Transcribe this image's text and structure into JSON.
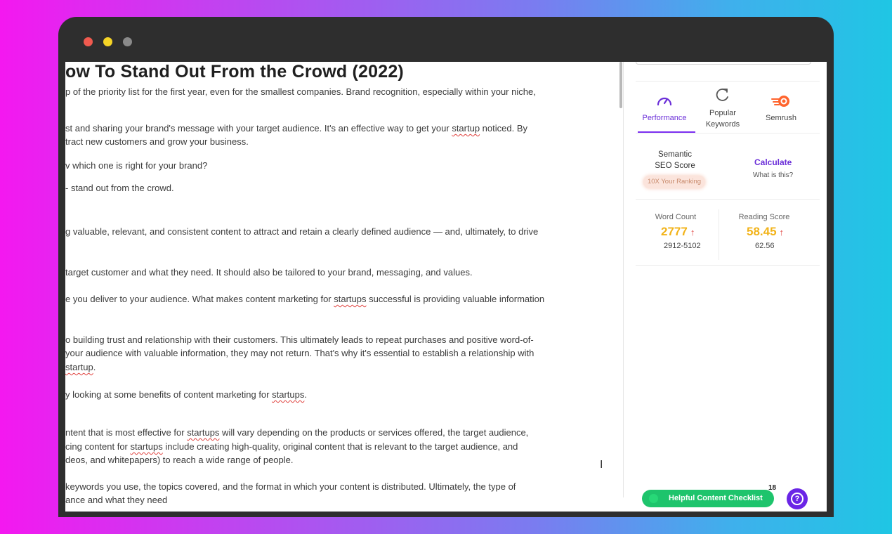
{
  "window": {
    "dot_colors": [
      "#f05a4f",
      "#f5d426",
      "#8a8a8a"
    ]
  },
  "editor": {
    "heading": "ow To Stand Out From the Crowd (2022)",
    "lines": [
      [
        {
          "t": "p of the priority list for the first year, even for the smallest companies. Brand recognition, especially within your niche,"
        }
      ],
      [
        {
          "t": "st and sharing your brand's message with your target audience. It's an effective way to get your "
        },
        {
          "t": "startup",
          "s": true
        },
        {
          "t": " noticed. By"
        }
      ],
      [
        {
          "t": "tract new customers and grow your business."
        }
      ],
      [
        {
          "t": "v which one is right for your brand?"
        }
      ],
      [
        {
          "t": "- stand out from the crowd."
        }
      ],
      [
        {
          "t": "g valuable, relevant, and consistent content to attract and retain a clearly defined audience — and, ultimately, to drive"
        }
      ],
      [
        {
          "t": "target customer and what they need. It should also be tailored to your brand, messaging, and values."
        }
      ],
      [
        {
          "t": "e you deliver to your audience. What makes content marketing for "
        },
        {
          "t": "startups",
          "s": true
        },
        {
          "t": " successful is providing valuable information"
        }
      ],
      [
        {
          "t": "o building trust and relationship with their customers. This ultimately leads to repeat purchases and positive word-of-"
        }
      ],
      [
        {
          "t": "your audience with valuable information, they may not return. That's why it's essential to establish a relationship with"
        }
      ],
      [
        {
          "t": " "
        },
        {
          "t": "startup",
          "s": true
        },
        {
          "t": "."
        }
      ],
      [
        {
          "t": "y looking at some benefits of content marketing for "
        },
        {
          "t": "startups",
          "s": true
        },
        {
          "t": "."
        }
      ],
      [
        {
          "t": "ntent that is most effective for "
        },
        {
          "t": "startups",
          "s": true
        },
        {
          "t": " will vary depending on the products or services offered, the target audience,"
        }
      ],
      [
        {
          "t": "cing content for "
        },
        {
          "t": "startups",
          "s": true
        },
        {
          "t": " include creating high-quality, original content that is relevant to the target audience, and"
        }
      ],
      [
        {
          "t": "deos, and whitepapers) to reach a wide range of people."
        }
      ],
      [
        {
          "t": " keywords you use, the topics covered, and the format in which your content is distributed. Ultimately, the type of"
        }
      ],
      [
        {
          "t": "ance and what they need"
        }
      ]
    ]
  },
  "panel": {
    "tabs": [
      {
        "label": "Performance",
        "icon": "gauge-icon",
        "active": true
      },
      {
        "label": "Popular Keywords",
        "icon": "refresh-icon",
        "active": false
      },
      {
        "label": "Semrush",
        "icon": "semrush-logo-icon",
        "active": false
      }
    ],
    "seo": {
      "label_line1": "Semantic",
      "label_line2": "SEO Score",
      "ranking_badge": "10X Your Ranking",
      "calculate": "Calculate",
      "what_is": "What is this?"
    },
    "stats": {
      "word_count": {
        "label": "Word Count",
        "value": "2777",
        "range": "2912-5102"
      },
      "reading_score": {
        "label": "Reading Score",
        "value": "58.45",
        "target": "62.56"
      }
    },
    "checklist": {
      "label": "Helpful Content Checklist",
      "count": "18"
    },
    "help": {
      "icon": "help-icon",
      "glyph": "?"
    },
    "colors": {
      "accent": "#6b2fd8",
      "checklist": "#1ec46c",
      "score": "#f2b319"
    }
  }
}
